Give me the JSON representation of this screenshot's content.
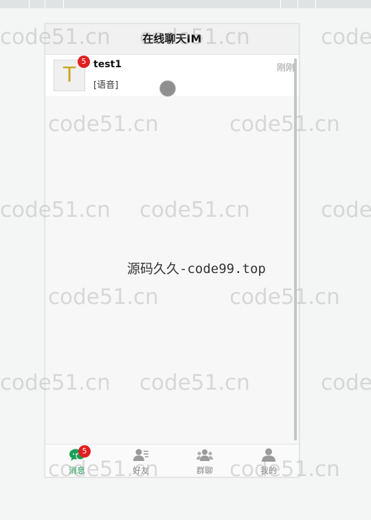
{
  "header": {
    "title": "在线聊天IM"
  },
  "chat_list": [
    {
      "avatar_letter": "T",
      "unread": "5",
      "name": "test1",
      "preview": "[语音]",
      "time": "刚刚"
    }
  ],
  "tabs": [
    {
      "label": "消息",
      "badge": "5",
      "icon": "chat-icon",
      "active": true
    },
    {
      "label": "好友",
      "icon": "contacts-icon"
    },
    {
      "label": "群聊",
      "icon": "group-icon"
    },
    {
      "label": "我的",
      "icon": "user-icon"
    }
  ],
  "overlay_text": "源码久久-code99.top",
  "watermark": "code51.cn",
  "colors": {
    "accent": "#1a9f56",
    "badge": "#e02020",
    "avatar_letter": "#c9a520"
  }
}
